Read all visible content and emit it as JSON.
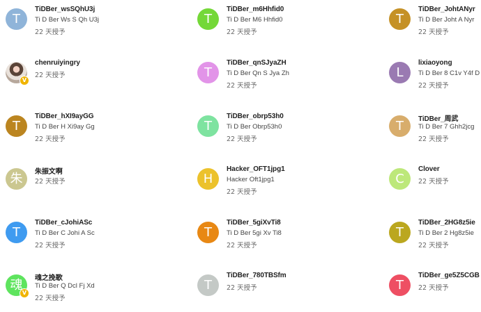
{
  "users": [
    {
      "avatar_letter": "T",
      "color": "#8fb4d9",
      "username": "TiDBer_wsSQhU3j",
      "full_name": "Ti D Ber Ws S Qh U3j",
      "granted": "22 天授予"
    },
    {
      "avatar_letter": "T",
      "color": "#74d838",
      "username": "TiDBer_m6Hhfid0",
      "full_name": "Ti D Ber M6 Hhfid0",
      "granted": "22 天授予"
    },
    {
      "avatar_letter": "T",
      "color": "#c59126",
      "username": "TiDBer_JohtANyr",
      "full_name": "Ti D Ber Joht A Nyr",
      "granted": "22 天授予"
    },
    {
      "avatar_letter": "",
      "color": "",
      "photo": true,
      "badge": "V",
      "username": "chenruiyingry",
      "full_name": "",
      "granted": "22 天授予"
    },
    {
      "avatar_letter": "T",
      "color": "#e294e8",
      "username": "TiDBer_qnSJyaZH",
      "full_name": "Ti D Ber Qn S Jya Zh",
      "granted": "22 天授予"
    },
    {
      "avatar_letter": "L",
      "color": "#9a7ab2",
      "username": "lixiaoyong",
      "full_name": "Ti D Ber 8 C1v Y4f D",
      "granted": "22 天授予"
    },
    {
      "avatar_letter": "T",
      "color": "#bb8520",
      "username": "TiDBer_hXI9ayGG",
      "full_name": "Ti D Ber H Xi9ay Gg",
      "granted": "22 天授予"
    },
    {
      "avatar_letter": "T",
      "color": "#7ee3a0",
      "username": "TiDBer_obrp53h0",
      "full_name": "Ti D Ber Obrp53h0",
      "granted": "22 天授予"
    },
    {
      "avatar_letter": "T",
      "color": "#d8ad6c",
      "username": "TiDBer_周武",
      "full_name": "Ti D Ber 7 Ghh2jcg",
      "granted": "22 天授予"
    },
    {
      "avatar_letter": "朱",
      "color": "#cbc790",
      "username": "朱振文啊",
      "full_name": "",
      "granted": "22 天授予"
    },
    {
      "avatar_letter": "H",
      "color": "#ecc22c",
      "username": "Hacker_OFT1jpg1",
      "full_name": "Hacker Oft1jpg1",
      "granted": "22 天授予"
    },
    {
      "avatar_letter": "C",
      "color": "#bde87a",
      "username": "Clover",
      "full_name": "",
      "granted": "22 天授予"
    },
    {
      "avatar_letter": "T",
      "color": "#3f9bf0",
      "username": "TiDBer_cJohiASc",
      "full_name": "Ti D Ber C Johi A Sc",
      "granted": "22 天授予"
    },
    {
      "avatar_letter": "T",
      "color": "#e88814",
      "username": "TiDBer_5giXvTi8",
      "full_name": "Ti D Ber 5gi Xv Ti8",
      "granted": "22 天授予"
    },
    {
      "avatar_letter": "T",
      "color": "#bba71f",
      "username": "TiDBer_2HG8z5ie",
      "full_name": "Ti D Ber 2 Hg8z5ie",
      "granted": "22 天授予"
    },
    {
      "avatar_letter": "魂",
      "color": "#5ee45e",
      "badge": "V",
      "username": "魂之挽歌",
      "full_name": "Ti D Ber Q Dcl Fj Xd",
      "granted": "22 天授予"
    },
    {
      "avatar_letter": "T",
      "color": "#c4c9c6",
      "username": "TiDBer_780TBSfm",
      "full_name": "",
      "granted": "22 天授予"
    },
    {
      "avatar_letter": "T",
      "color": "#ee4f63",
      "username": "TiDBer_ge5Z5CGB",
      "full_name": "",
      "granted": "22 天授予"
    }
  ]
}
